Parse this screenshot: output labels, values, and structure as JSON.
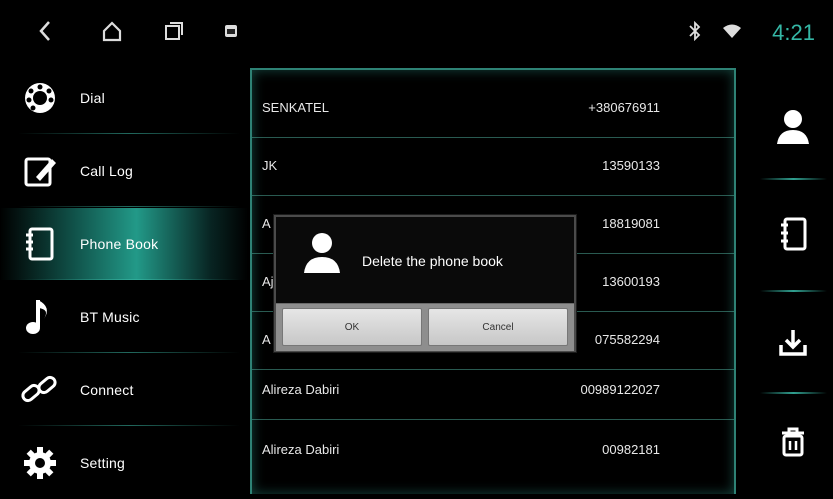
{
  "status_bar": {
    "time": "4:21",
    "icons": [
      "back-icon",
      "home-icon",
      "recent-apps-icon",
      "notification-icon",
      "bluetooth-icon",
      "wifi-icon"
    ],
    "accent_color": "#35b7a6"
  },
  "sidebar": {
    "items": [
      {
        "label": "Dial",
        "icon": "dial-icon",
        "active": false
      },
      {
        "label": "Call Log",
        "icon": "call-log-icon",
        "active": false
      },
      {
        "label": "Phone Book",
        "icon": "phone-book-icon",
        "active": true
      },
      {
        "label": "BT Music",
        "icon": "music-note-icon",
        "active": false
      },
      {
        "label": "Connect",
        "icon": "link-icon",
        "active": false
      },
      {
        "label": "Setting",
        "icon": "gear-icon",
        "active": false
      }
    ]
  },
  "contacts": [
    {
      "name": "SENKATEL",
      "number": "+380676911"
    },
    {
      "name": "JK",
      "number": "13590133"
    },
    {
      "name": "A",
      "number": "18819081"
    },
    {
      "name": "Aj",
      "number": "13600193"
    },
    {
      "name": "A",
      "number": "075582294"
    },
    {
      "name": "Alireza  Dabiri",
      "number": "00989122027"
    },
    {
      "name": "Alireza  Dabiri",
      "number": "00982181"
    }
  ],
  "right_bar": {
    "buttons": [
      "contact-icon",
      "phone-book-icon",
      "download-icon",
      "trash-icon"
    ]
  },
  "dialog": {
    "message": "Delete the phone book",
    "ok_label": "OK",
    "cancel_label": "Cancel"
  }
}
